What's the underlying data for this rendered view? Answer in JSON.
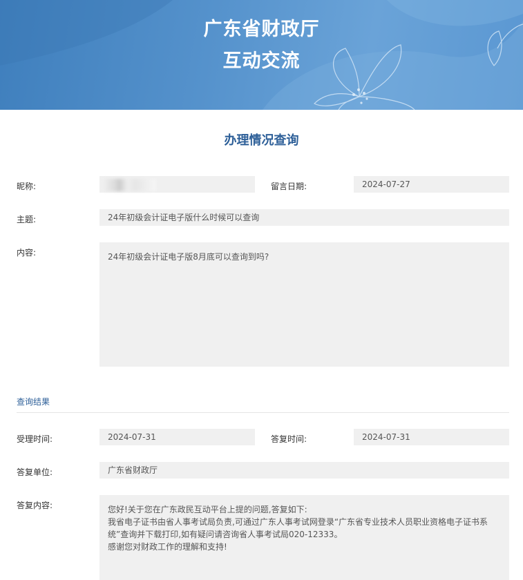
{
  "banner": {
    "title_line1": "广东省财政厅",
    "title_line2": "互动交流"
  },
  "page_title": "办理情况查询",
  "query": {
    "nickname_label": "昵称:",
    "nickname_value": "",
    "date_label": "留言日期:",
    "date_value": "2024-07-27",
    "subject_label": "主题:",
    "subject_value": "24年初级会计证电子版什么时候可以查询",
    "content_label": "内容:",
    "content_value": "24年初级会计证电子版8月底可以查询到吗?"
  },
  "result": {
    "heading": "查询结果",
    "accept_time_label": "受理时间:",
    "accept_time_value": "2024-07-31",
    "reply_time_label": "答复时间:",
    "reply_time_value": "2024-07-31",
    "reply_unit_label": "答复单位:",
    "reply_unit_value": "广东省财政厅",
    "reply_content_label": "答复内容:",
    "reply_lines": [
      "您好!关于您在广东政民互动平台上提的问题,答复如下:",
      "我省电子证书由省人事考试局负责,可通过广东人事考试网登录“广东省专业技术人员职业资格电子证书系统”查询并下载打印,如有疑问请咨询省人事考试局020-12333。",
      "感谢您对财政工作的理解和支持!"
    ]
  },
  "colors": {
    "banner": "#5592cc",
    "accent": "#2d5f98",
    "field_bg": "#f0f0f0"
  },
  "icons": {
    "banner_decoration": "flower-decoration-icon"
  }
}
